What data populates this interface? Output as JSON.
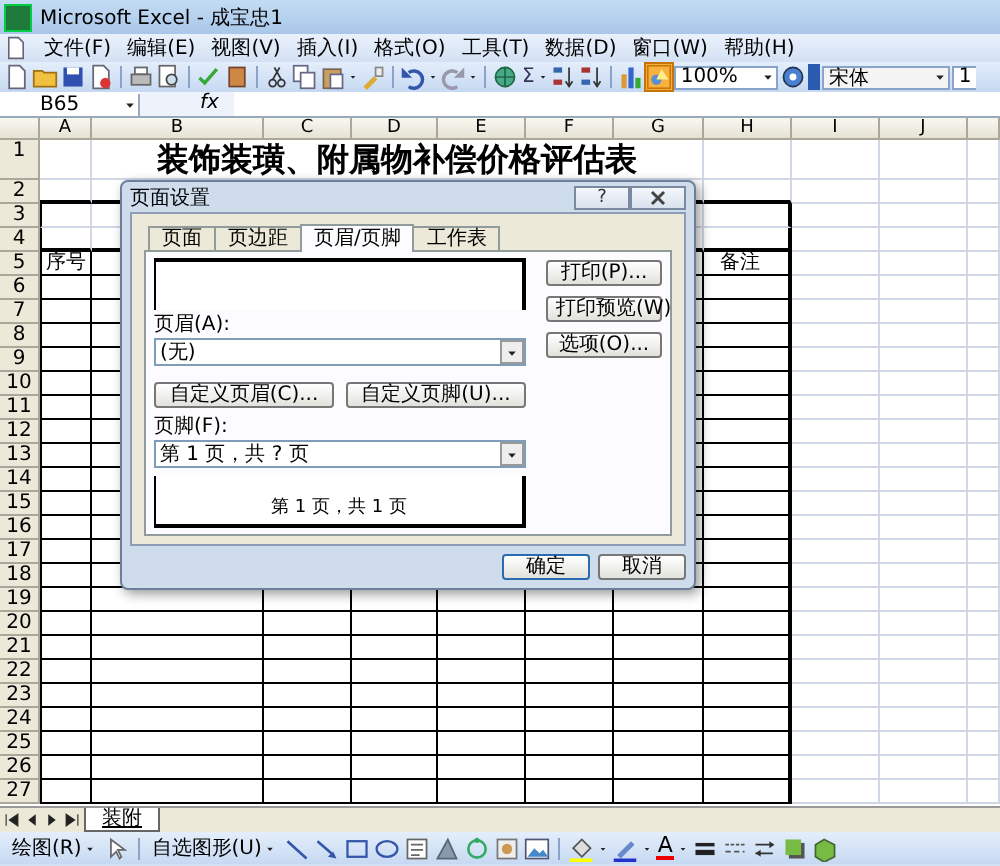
{
  "window": {
    "title": "Microsoft Excel - 成宝忠1"
  },
  "menu": [
    {
      "label": "文件(F)"
    },
    {
      "label": "编辑(E)"
    },
    {
      "label": "视图(V)"
    },
    {
      "label": "插入(I)"
    },
    {
      "label": "格式(O)"
    },
    {
      "label": "工具(T)"
    },
    {
      "label": "数据(D)"
    },
    {
      "label": "窗口(W)"
    },
    {
      "label": "帮助(H)"
    }
  ],
  "toolbar": {
    "autosum": "Σ",
    "zoom": "100%",
    "font": "宋体",
    "font_size": "1"
  },
  "formula_bar": {
    "name_box": "B65",
    "function_label": "fx"
  },
  "columns": [
    "A",
    "B",
    "C",
    "D",
    "E",
    "F",
    "G",
    "H",
    "I",
    "J"
  ],
  "rows": [
    "1",
    "2",
    "3",
    "4",
    "5",
    "6",
    "7",
    "8",
    "9",
    "10",
    "11",
    "12",
    "13",
    "14",
    "15",
    "16",
    "17",
    "18",
    "19",
    "20",
    "21",
    "22",
    "23",
    "24",
    "25",
    "26",
    "27"
  ],
  "sheet": {
    "title": "装饰装璜、附属物补偿价格评估表",
    "table_headers": [
      "序号",
      "备注"
    ]
  },
  "dialog": {
    "title": "页面设置",
    "help": "?",
    "tabs": [
      {
        "label": "页面",
        "selected": false
      },
      {
        "label": "页边距",
        "selected": false
      },
      {
        "label": "页眉/页脚",
        "selected": true
      },
      {
        "label": "工作表",
        "selected": false
      }
    ],
    "header_label": "页眉(A):",
    "header_value": "(无)",
    "custom_buttons": [
      "自定义页眉(C)...",
      "自定义页脚(U)..."
    ],
    "footer_label": "页脚(F):",
    "footer_value": "第 1 页，共 ? 页",
    "footer_preview": "第 1 页，共 1 页",
    "side_buttons": [
      "打印(P)...",
      "打印预览(W)",
      "选项(O)..."
    ],
    "ok": "确定",
    "cancel": "取消"
  },
  "sheet_tabs": [
    {
      "label": "装附",
      "selected": true
    }
  ],
  "drawing_toolbar": {
    "draw_menu": "绘图(R)",
    "autoshapes_menu": "自选图形(U)",
    "font_color_glyph": "A"
  }
}
